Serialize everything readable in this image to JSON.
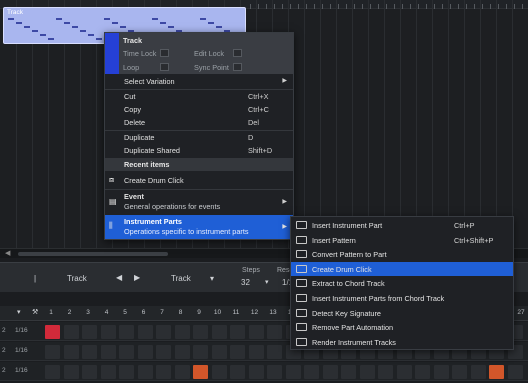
{
  "arrange": {
    "track_part_name": "Track"
  },
  "context_menu": {
    "header": {
      "title": "Track",
      "time_lock": "Time Lock",
      "edit_lock": "Edit Lock",
      "loop": "Loop",
      "sync_point": "Sync Point"
    },
    "items": [
      {
        "label": "Select Variation",
        "shortcut": ""
      },
      {
        "label": "Cut",
        "shortcut": "Ctrl+X"
      },
      {
        "label": "Copy",
        "shortcut": "Ctrl+C"
      },
      {
        "label": "Delete",
        "shortcut": "Del"
      },
      {
        "label": "Duplicate",
        "shortcut": "D"
      },
      {
        "label": "Duplicate Shared",
        "shortcut": "Shift+D"
      }
    ],
    "recent_header": "Recent items",
    "recent_item": "Create Drum Click",
    "event": {
      "label": "Event",
      "desc": "General operations for events"
    },
    "instrument_parts": {
      "label": "Instrument Parts",
      "desc": "Operations specific to instrument parts"
    }
  },
  "submenu": {
    "items": [
      {
        "label": "Insert Instrument Part",
        "shortcut": "Ctrl+P",
        "icon": "insert-part-icon"
      },
      {
        "label": "Insert Pattern",
        "shortcut": "Ctrl+Shift+P",
        "icon": "pattern-icon"
      },
      {
        "label": "Convert Pattern to Part",
        "shortcut": "",
        "icon": "convert-icon"
      },
      {
        "label": "Create Drum Click",
        "shortcut": "",
        "icon": "drum-icon"
      },
      {
        "label": "Extract to Chord Track",
        "shortcut": "",
        "icon": "chord-extract-icon"
      },
      {
        "label": "Insert Instrument Parts from Chord Track",
        "shortcut": "",
        "icon": "chord-parts-icon"
      },
      {
        "label": "Detect Key Signature",
        "shortcut": "",
        "icon": "key-signature-icon"
      },
      {
        "label": "Remove Part Automation",
        "shortcut": "",
        "icon": "automation-icon"
      },
      {
        "label": "Render Instrument Tracks",
        "shortcut": "",
        "icon": "render-icon"
      }
    ],
    "highlighted_index": 3
  },
  "editor_bar": {
    "track_1": "Track",
    "track_2": "Track",
    "steps_label": "Steps",
    "steps_value": "32",
    "reso_label": "Reso",
    "reso_value": "1/1"
  },
  "step_grid": {
    "steps": [
      "1",
      "2",
      "3",
      "4",
      "5",
      "6",
      "7",
      "8",
      "9",
      "10",
      "11",
      "12",
      "13",
      "14",
      "15",
      "16"
    ],
    "right_step": "27",
    "rows": [
      {
        "num": "2",
        "div": "1/16"
      },
      {
        "num": "2",
        "div": "1/16"
      },
      {
        "num": "2",
        "div": "1/16"
      }
    ]
  },
  "colors": {
    "accent": "#1f5fd6",
    "part": "#a9b6ef",
    "active_step": "#d22a3a",
    "orange_step": "#d2562a"
  }
}
